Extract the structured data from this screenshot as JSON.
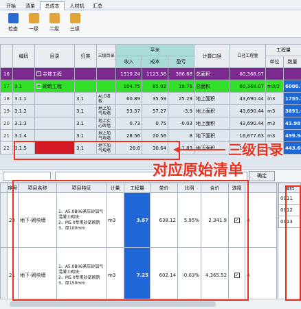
{
  "tabs": [
    {
      "label": "开始"
    },
    {
      "label": "清单"
    },
    {
      "label": "总成本"
    },
    {
      "label": "人材机"
    },
    {
      "label": "汇总"
    }
  ],
  "toolbar": [
    {
      "label": "检查",
      "color": "#2a6ad1"
    },
    {
      "label": "一级",
      "color": "#e0a43b"
    },
    {
      "label": "二级",
      "color": "#e0a43b"
    },
    {
      "label": "三级",
      "color": "#e0a43b"
    }
  ],
  "grid1": {
    "headers": {
      "code": "编码",
      "item": "目录",
      "category": "归类",
      "level3": "三级目录",
      "sqm": "平米",
      "income": "收入",
      "cost": "成本",
      "profit": "盈亏",
      "calibre": "计算口径",
      "calibre_qty": "口径工程量",
      "quantities": "工程量",
      "unit": "单位",
      "amount": "数量"
    },
    "rows": [
      {
        "no": "16",
        "code": "",
        "item": "主体工程",
        "cat": "",
        "l3": "",
        "income": "1510.24",
        "cost": "1123.56",
        "profit": "386.68",
        "calibre": "总面积",
        "cqty": "60,368.07",
        "unit": "",
        "amount": "",
        "style": "r16"
      },
      {
        "no": "17",
        "code": "3.1",
        "item": "砌筑工程",
        "cat": "",
        "l3": "",
        "income": "104.75",
        "cost": "85.02",
        "profit": "19.76",
        "calibre": "总面积",
        "cqty": "60,368.07",
        "unit": "m3/2",
        "amount": "6000.75",
        "style": "r17"
      },
      {
        "no": "18",
        "code": "3.1.1",
        "item": "",
        "cat": "3.1",
        "l3": "ALC墙板",
        "income": "60.89",
        "cost": "35.59",
        "profit": "25.29",
        "calibre": "地上面积",
        "cqty": "43,690.44",
        "unit": "m3",
        "amount": "1755.26",
        "style": ""
      },
      {
        "no": "19",
        "code": "3.1.2",
        "item": "",
        "cat": "3.1",
        "l3": "地上加气块墙",
        "income": "53.37",
        "cost": "57.27",
        "profit": "-3.9",
        "calibre": "地上面积",
        "cqty": "43,690.44",
        "unit": "m3",
        "amount": "3891.97",
        "style": ""
      },
      {
        "no": "20",
        "code": "3.1.3",
        "item": "",
        "cat": "3.1",
        "l3": "地上实心砖墙",
        "income": "0.73",
        "cost": "0.75",
        "profit": "-0.03",
        "calibre": "地上面积",
        "cqty": "43,690.44",
        "unit": "m3",
        "amount": "43.98",
        "style": ""
      },
      {
        "no": "21",
        "code": "3.1.4",
        "item": "",
        "cat": "3.1",
        "l3": "地上加气块墙",
        "income": "28.56",
        "cost": "20.56",
        "profit": "8",
        "calibre": "地下面积",
        "cqty": "16,677.63",
        "unit": "m3",
        "amount": "499.94",
        "style": ""
      },
      {
        "no": "22",
        "code": "3.1.5",
        "item": "",
        "cat": "3.1",
        "l3": "地下加气块墙",
        "income": "28.8",
        "cost": "30.64",
        "profit": "-1.83",
        "calibre": "地下面积",
        "cqty": "16,677.63",
        "unit": "m3",
        "amount": "443.60",
        "style": "r22"
      }
    ]
  },
  "confirm_button": "确定",
  "grid2": {
    "headers": {
      "no": "序号",
      "name": "项目名称",
      "feature": "项目特征",
      "unit": "计量",
      "qty": "工程量",
      "c6": "单价",
      "c7": "比例",
      "c8": "合价",
      "c9": "选择"
    },
    "rows": [
      {
        "no": "20",
        "name": "地下-砌块墙",
        "feature": "1、A5.0B06蒸压砂加气混凝土砌块\n2、M5.0专用砂浆砌筑\n3、厚100mm",
        "unit": "m3",
        "qty": "3.67",
        "price": "638.12",
        "ratio": "5.95%",
        "total": "2,341.9",
        "c10": "4"
      },
      {
        "no": "21",
        "name": "地下-砌块墙",
        "feature": "1、A5.0B06蒸压砂加气混凝土砌块\n2、M5.0专用砂浆砌筑\n3、厚150mm",
        "unit": "m3",
        "qty": "7.25",
        "price": "602.14",
        "ratio": "-0.03%",
        "total": "4,365.52",
        "c10": "4"
      }
    ]
  },
  "side_list": {
    "header": "编码",
    "items": [
      "0011",
      "0012",
      "0013"
    ]
  },
  "annotations": {
    "level3": "三级目录",
    "original": "对应原始清单"
  }
}
